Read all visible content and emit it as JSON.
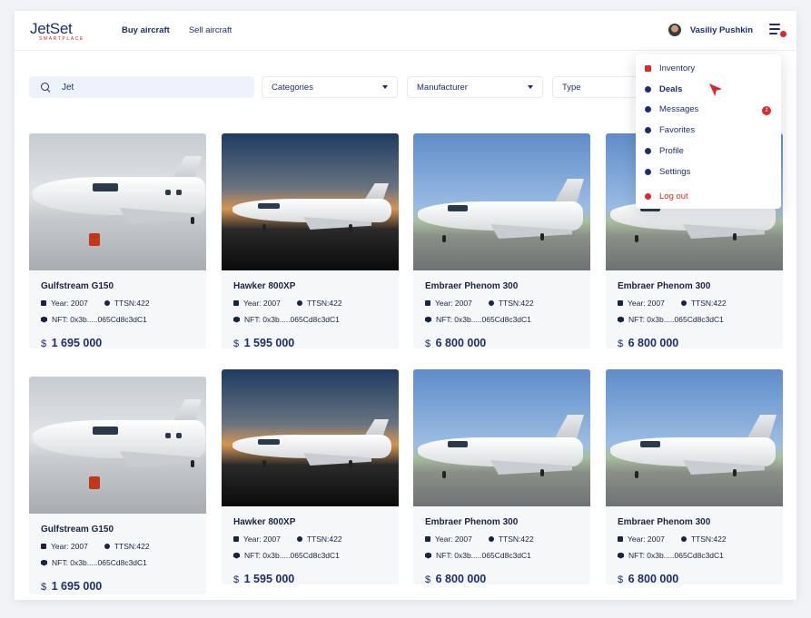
{
  "header": {
    "logo_main": "JetSet",
    "logo_sub": "SMARTPLACE",
    "nav": [
      "Buy aircraft",
      "Sell aircraft"
    ],
    "user_name": "Vasiliy Pushkin"
  },
  "filters": {
    "search_value": "Jet",
    "categories": "Categories",
    "manufacturer": "Manufacturer",
    "type": "Type"
  },
  "menu": {
    "items": [
      "Inventory",
      "Deals",
      "Messages",
      "Favorites",
      "Profile",
      "Settings"
    ],
    "logout": "Log out",
    "messages_badge": "2"
  },
  "cards": [
    {
      "title": "Gulfstream G150",
      "year": "Year: 2007",
      "ttsn": "TTSN:422",
      "nft": "NFT: 0x3b.....065Cd8c3dC1",
      "currency": "$",
      "price": "1 695 000"
    },
    {
      "title": "Hawker 800XP",
      "year": "Year: 2007",
      "ttsn": "TTSN:422",
      "nft": "NFT: 0x3b.....065Cd8c3dC1",
      "currency": "$",
      "price": "1 595 000"
    },
    {
      "title": "Embraer Phenom 300",
      "year": "Year: 2007",
      "ttsn": "TTSN:422",
      "nft": "NFT: 0x3b.....065Cd8c3dC1",
      "currency": "$",
      "price": "6 800 000"
    },
    {
      "title": "Embraer Phenom 300",
      "year": "Year: 2007",
      "ttsn": "TTSN:422",
      "nft": "NFT: 0x3b.....065Cd8c3dC1",
      "currency": "$",
      "price": "6 800 000"
    },
    {
      "title": "Gulfstream G150",
      "year": "Year: 2007",
      "ttsn": "TTSN:422",
      "nft": "NFT: 0x3b.....065Cd8c3dC1",
      "currency": "$",
      "price": "1 695 000"
    },
    {
      "title": "Hawker 800XP",
      "year": "Year: 2007",
      "ttsn": "TTSN:422",
      "nft": "NFT: 0x3b.....065Cd8c3dC1",
      "currency": "$",
      "price": "1 595 000"
    },
    {
      "title": "Embraer Phenom 300",
      "year": "Year: 2007",
      "ttsn": "TTSN:422",
      "nft": "NFT: 0x3b.....065Cd8c3dC1",
      "currency": "$",
      "price": "6 800 000"
    },
    {
      "title": "Embraer Phenom 300",
      "year": "Year: 2007",
      "ttsn": "TTSN:422",
      "nft": "NFT: 0x3b.....065Cd8c3dC1",
      "currency": "$",
      "price": "6 800 000"
    }
  ]
}
